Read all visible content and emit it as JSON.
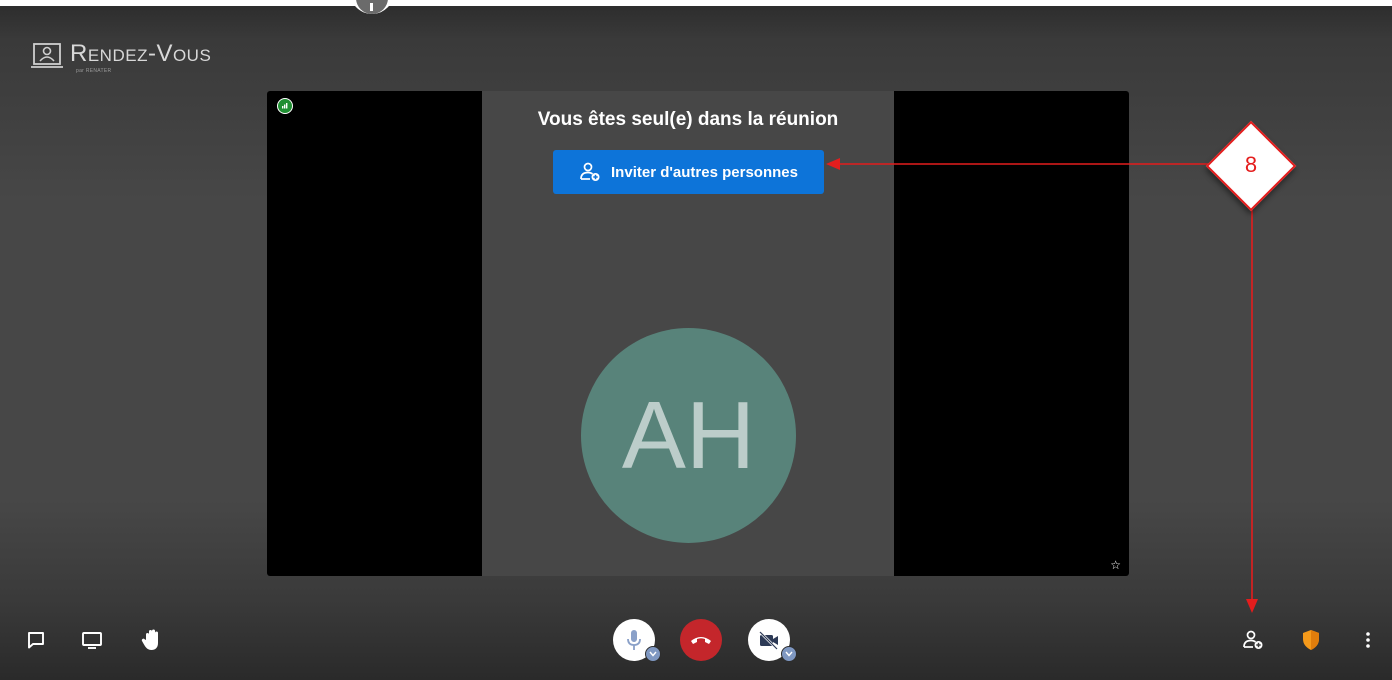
{
  "app": {
    "logo_text": "Rendez-Vous",
    "logo_subtext": "par RENATER"
  },
  "meeting": {
    "alone_message": "Vous êtes seul(e) dans la réunion",
    "invite_button_label": "Inviter d'autres personnes",
    "avatar_initials": "AH"
  },
  "annotation": {
    "label": "8"
  },
  "icons": {
    "connection": "signal-bars-icon",
    "pin": "star-icon",
    "chat": "chat-icon",
    "screenshare": "screen-icon",
    "raise_hand": "hand-icon",
    "microphone": "microphone-icon",
    "hangup": "phone-hangup-icon",
    "camera_off": "camera-off-icon",
    "invite": "add-person-icon",
    "security": "shield-icon",
    "more": "more-vertical-icon"
  },
  "colors": {
    "invite_button": "#0d74d9",
    "hangup_button": "#c4262b",
    "avatar": "#58837a",
    "annotation": "#e41d1d",
    "signal": "#1f8f32",
    "security_shield": "#f59a1b"
  }
}
